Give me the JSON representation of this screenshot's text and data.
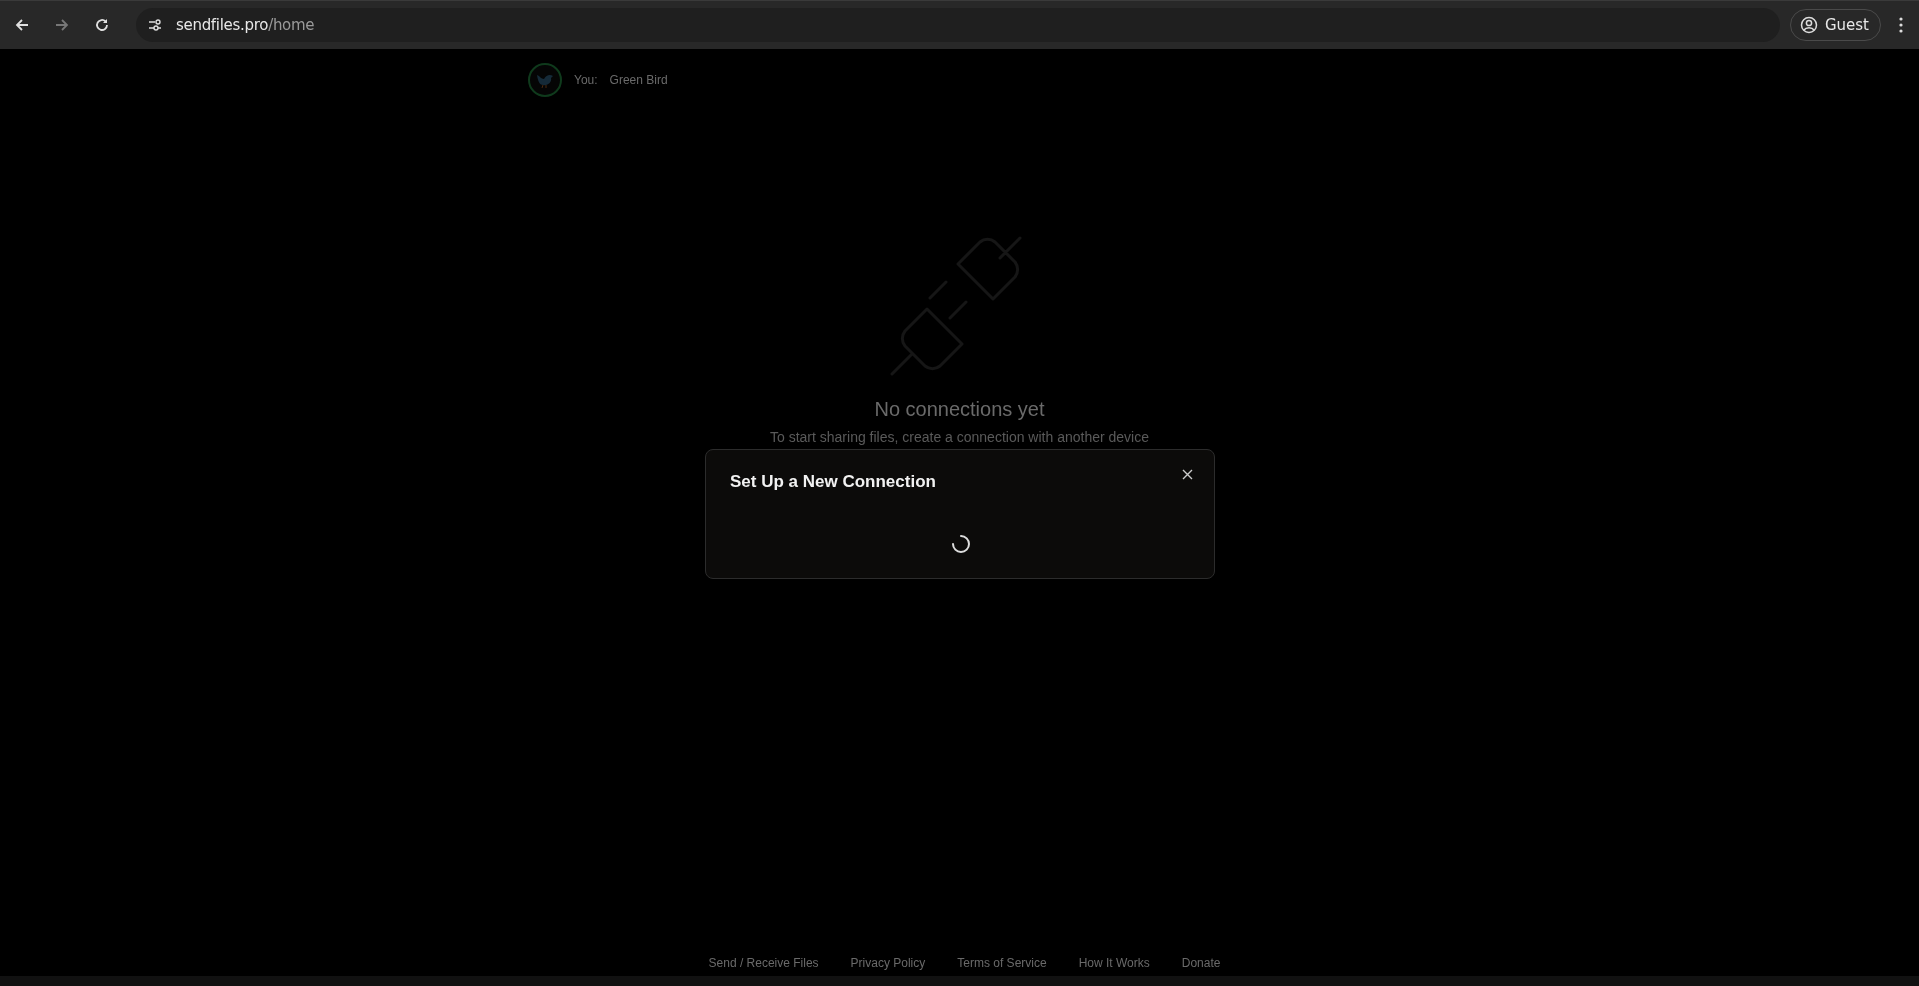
{
  "browser": {
    "url_host": "sendfiles.pro",
    "url_path": "/home",
    "profile": "Guest",
    "forward_disabled": true
  },
  "user": {
    "label": "You:",
    "name": "Green Bird"
  },
  "empty_state": {
    "title": "No connections yet",
    "subtitle": "To start sharing files, create a connection with another device"
  },
  "dialog": {
    "title": "Set Up a New Connection",
    "loading": true
  },
  "footer": {
    "links": [
      "Send / Receive Files",
      "Privacy Policy",
      "Terms of Service",
      "How It Works",
      "Donate"
    ]
  }
}
